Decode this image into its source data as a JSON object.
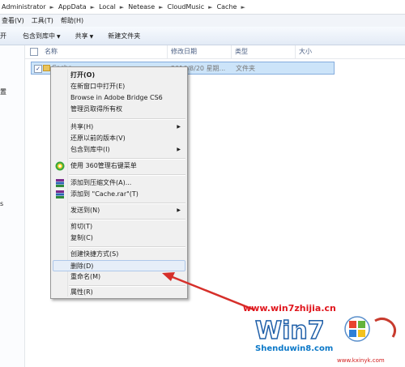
{
  "breadcrumb": [
    "Administrator",
    "AppData",
    "Local",
    "Netease",
    "CloudMusic",
    "Cache"
  ],
  "menubar": [
    "查看(V)",
    "工具(T)",
    "帮助(H)"
  ],
  "toolbar": {
    "open": "开",
    "include_in_library": "包含到库中",
    "share": "共享",
    "new_folder": "新建文件夹"
  },
  "nav": {
    "item1": "置",
    "item2": "s"
  },
  "columns": {
    "name": "名称",
    "date_modified": "修改日期",
    "type": "类型",
    "size": "大小"
  },
  "row": {
    "name": "Cache",
    "date": "2016/8/20 星期...",
    "type": "文件夹"
  },
  "context_menu": {
    "open": "打开(O)",
    "open_new_window": "在新窗口中打开(E)",
    "browse_bridge": "Browse in Adobe Bridge CS6",
    "take_ownership": "管理员取得所有权",
    "share": "共享(H)",
    "restore_versions": "还原以前的版本(V)",
    "include_library": "包含到库中(I)",
    "use_360": "使用 360管理右键菜单",
    "add_archive": "添加到压缩文件(A)...",
    "add_cache_rar": "添加到 \"Cache.rar\"(T)",
    "send_to": "发送到(N)",
    "cut": "剪切(T)",
    "copy": "复制(C)",
    "create_shortcut": "创建快捷方式(S)",
    "delete": "删除(D)",
    "rename": "重命名(M)",
    "properties": "属性(R)"
  },
  "watermark": {
    "url": "www.win7zhijia.cn",
    "logo_text": "Win7",
    "site": "Shenduwin8.com",
    "site2": "www.kxinyk.com"
  },
  "colors": {
    "accent_red": "#e0161d",
    "highlight": "#cce4f9"
  }
}
